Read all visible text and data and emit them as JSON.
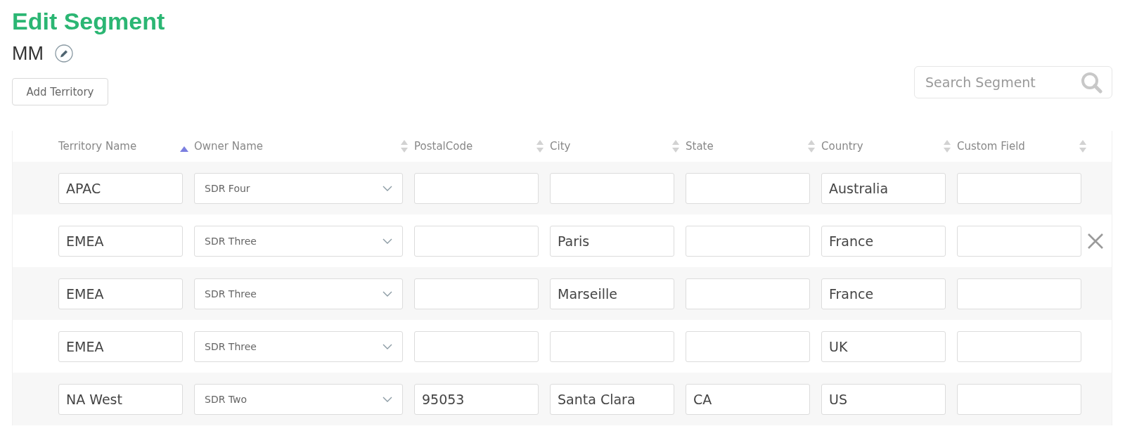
{
  "title": "Edit Segment",
  "segment_name": "MM",
  "add_button": "Add Territory",
  "search": {
    "placeholder": "Search Segment"
  },
  "table": {
    "columns": [
      {
        "label": "Territory Name",
        "sorted": true
      },
      {
        "label": "Owner Name",
        "sorted": false
      },
      {
        "label": "PostalCode",
        "sorted": false
      },
      {
        "label": "City",
        "sorted": false
      },
      {
        "label": "State",
        "sorted": false
      },
      {
        "label": "Country",
        "sorted": false
      },
      {
        "label": "Custom Field",
        "sorted": false
      }
    ],
    "rows": [
      {
        "territory": "APAC",
        "owner": "SDR Four",
        "postal_code": "",
        "city": "",
        "state": "",
        "country": "Australia",
        "custom_field": "",
        "remove_shown": false
      },
      {
        "territory": "EMEA",
        "owner": "SDR Three",
        "postal_code": "",
        "city": "Paris",
        "state": "",
        "country": "France",
        "custom_field": "",
        "remove_shown": true
      },
      {
        "territory": "EMEA",
        "owner": "SDR Three",
        "postal_code": "",
        "city": "Marseille",
        "state": "",
        "country": "France",
        "custom_field": "",
        "remove_shown": false
      },
      {
        "territory": "EMEA",
        "owner": "SDR Three",
        "postal_code": "",
        "city": "",
        "state": "",
        "country": "UK",
        "custom_field": "",
        "remove_shown": false
      },
      {
        "territory": "NA West",
        "owner": "SDR Two",
        "postal_code": "95053",
        "city": "Santa Clara",
        "state": "CA",
        "country": "US",
        "custom_field": "",
        "remove_shown": false
      }
    ]
  }
}
